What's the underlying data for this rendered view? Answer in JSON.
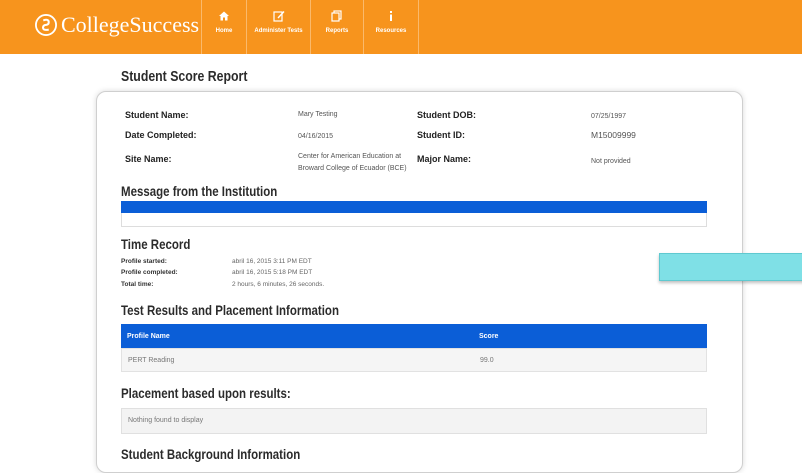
{
  "brand": {
    "name": "CollegeSuccess",
    "bar_color": "#f7941d"
  },
  "nav": [
    {
      "label": "Home",
      "icon": "home-icon"
    },
    {
      "label": "Administer Tests",
      "icon": "edit-icon"
    },
    {
      "label": "Reports",
      "icon": "reports-icon"
    },
    {
      "label": "Resources",
      "icon": "info-icon"
    }
  ],
  "report": {
    "title": "Student Score Report",
    "student_name_label": "Student Name:",
    "student_name": "Mary Testing",
    "dob_label": "Student DOB:",
    "dob": "07/25/1997",
    "date_completed_label": "Date Completed:",
    "date_completed": "04/16/2015",
    "student_id_label": "Student ID:",
    "student_id": "M15009999",
    "site_name_label": "Site Name:",
    "site_name_line1": "Center for American Education at",
    "site_name_line2": "Broward College of Ecuador (BCE)",
    "major_label": "Major Name:",
    "major": "Not provided"
  },
  "message": {
    "title": "Message from the Institution",
    "accent": "#0b5ed7"
  },
  "time_record": {
    "title": "Time Record",
    "started_label": "Profile started:",
    "started": "abril 16, 2015 3:11 PM EDT",
    "completed_label": "Profile completed:",
    "completed": "abril 16, 2015 5:18 PM EDT",
    "total_label": "Total time:",
    "total": "2 hours, 6 minutes, 26 seconds."
  },
  "results": {
    "title": "Test Results and Placement Information",
    "headers": [
      "Profile Name",
      "Score"
    ],
    "rows": [
      [
        "PERT Reading",
        "99.0"
      ]
    ]
  },
  "placement": {
    "title": "Placement based upon results:",
    "empty_text": "Nothing found to display"
  },
  "background": {
    "title": "Student Background Information"
  }
}
